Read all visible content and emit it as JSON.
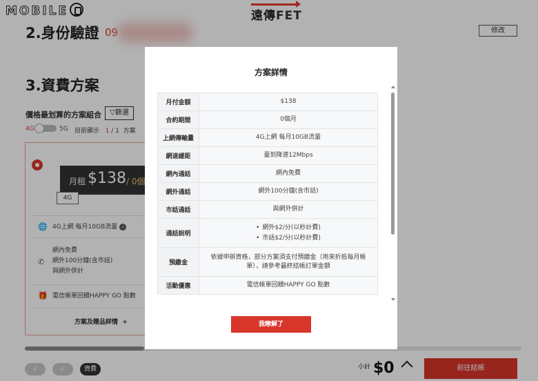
{
  "watermark": {
    "text": "MOBILE"
  },
  "header": {
    "brand_cn": "遠傳",
    "brand_en": "FET"
  },
  "section2": {
    "title": "2.身份驗證",
    "phone_partial": "09",
    "edit_label": "修改"
  },
  "section3": {
    "title": "3.資費方案",
    "best_label": "價格最划算的方案組合",
    "filter_label": "篩選",
    "net_4g": "4G",
    "net_5g": "5G",
    "showing_text": "目前顯示",
    "showing_current": "1",
    "showing_sep": "/",
    "showing_total": "1",
    "showing_unit": "方案"
  },
  "plan_card": {
    "price_label": "月租",
    "price_value": "$138",
    "price_unit": "/ 0個",
    "network_tag": "4G",
    "data_feature": "4G上網 每月10GB流量",
    "call_features": [
      "網內免費",
      "網外100分鐘(含市話)",
      "與網外併計"
    ],
    "gift_feature": "電信帳單回饋HAPPY GO 點數",
    "detail_link": "方案及贈品詳情",
    "detail_plus": "+"
  },
  "bottom": {
    "step3_label": "資費",
    "subtotal_label": "小計",
    "subtotal_value": "$0",
    "checkout_label": "前往結帳"
  },
  "modal": {
    "title": "方案詳情",
    "rows": [
      {
        "label": "月付金額",
        "value": "$138"
      },
      {
        "label": "合約期間",
        "value": "0個月"
      },
      {
        "label": "上網傳輸量",
        "value": "4G上網 每月10GB流量"
      },
      {
        "label": "網速緩距",
        "value": "量到降速12Mbps"
      },
      {
        "label": "網內通話",
        "value": "網內免費"
      },
      {
        "label": "網外通話",
        "value": "網外100分鐘(含市話)"
      },
      {
        "label": "市話通話",
        "value": "與網外併計"
      },
      {
        "label": "通話說明",
        "items": [
          "網外$2/分(以秒計費)",
          "市話$2/分(以秒計費)"
        ]
      },
      {
        "label": "預繳金",
        "value": "依據申辦資格，部分方案須支付預繳金（用來折抵每月帳單），請參考最終結帳訂單金額"
      },
      {
        "label": "活動優惠",
        "value": "電信帳單回饋HAPPY GO 點數"
      }
    ],
    "ok_label": "我瞭解了"
  },
  "progress": {
    "fraction": 0.24
  },
  "colors": {
    "accent": "#d8362b",
    "dark": "#333333"
  },
  "icons": [
    "globe-icon",
    "phone-icon",
    "gift-icon",
    "filter-icon",
    "info-icon",
    "chevron-up-icon",
    "check-icon"
  ]
}
